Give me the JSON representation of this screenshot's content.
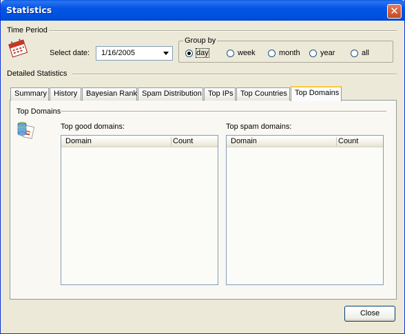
{
  "window": {
    "title": "Statistics"
  },
  "time_period": {
    "label": "Time Period",
    "select_date_label": "Select date:",
    "date_value": "1/16/2005",
    "group_by": {
      "label": "Group by",
      "options": [
        "day",
        "week",
        "month",
        "year",
        "all"
      ],
      "selected": "day"
    }
  },
  "detailed": {
    "label": "Detailed Statistics",
    "tabs": [
      "Summary",
      "History",
      "Bayesian Rank",
      "Spam Distribution",
      "Top IPs",
      "Top Countries",
      "Top Domains"
    ],
    "active_tab": "Top Domains"
  },
  "top_domains": {
    "section_label": "Top Domains",
    "good": {
      "title": "Top good domains:",
      "columns": [
        "Domain",
        "Count"
      ],
      "rows": []
    },
    "spam": {
      "title": "Top spam domains:",
      "columns": [
        "Domain",
        "Count"
      ],
      "rows": []
    }
  },
  "footer": {
    "close_label": "Close"
  },
  "colors": {
    "title_bar": "#0050e0",
    "close_button": "#c9471f",
    "active_tab_accent": "#ffc83c"
  }
}
